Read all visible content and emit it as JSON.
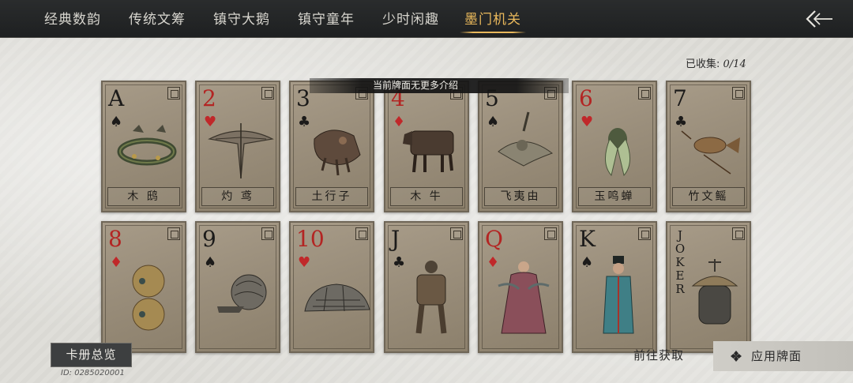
{
  "tabs": [
    {
      "label": "经典数韵",
      "active": false
    },
    {
      "label": "传统文筹",
      "active": false
    },
    {
      "label": "镇守大鹅",
      "active": false
    },
    {
      "label": "镇守童年",
      "active": false
    },
    {
      "label": "少时闲趣",
      "active": false
    },
    {
      "label": "墨门机关",
      "active": true
    }
  ],
  "collected": {
    "label": "已收集: ",
    "count": "0/14"
  },
  "tooltip": "当前牌面无更多介绍",
  "cards_row1": [
    {
      "rank": "A",
      "suit": "♠",
      "suit_color": "black",
      "name": "木 鸱",
      "icon": "wooden-kite-icon"
    },
    {
      "rank": "2",
      "suit": "♥",
      "suit_color": "red",
      "name": "灼 鸢",
      "icon": "glider-icon"
    },
    {
      "rank": "3",
      "suit": "♣",
      "suit_color": "black",
      "name": "土行子",
      "icon": "mole-machine-icon"
    },
    {
      "rank": "4",
      "suit": "♦",
      "suit_color": "red",
      "name": "木 牛",
      "icon": "wooden-ox-icon"
    },
    {
      "rank": "5",
      "suit": "♠",
      "suit_color": "black",
      "name": "飞夷由",
      "icon": "flying-squirrel-icon"
    },
    {
      "rank": "6",
      "suit": "♥",
      "suit_color": "red",
      "name": "玉鸣蝉",
      "icon": "cicada-icon"
    },
    {
      "rank": "7",
      "suit": "♣",
      "suit_color": "black",
      "name": "竹文鳐",
      "icon": "flying-fish-icon"
    }
  ],
  "cards_row2": [
    {
      "rank": "8",
      "suit": "♦",
      "suit_color": "red",
      "icon": "gourd-bot-icon"
    },
    {
      "rank": "9",
      "suit": "♠",
      "suit_color": "black",
      "icon": "snail-machine-icon"
    },
    {
      "rank": "10",
      "suit": "♥",
      "suit_color": "red",
      "icon": "armadillo-machine-icon"
    },
    {
      "rank": "J",
      "suit": "♣",
      "suit_color": "black",
      "icon": "mech-warrior-icon"
    },
    {
      "rank": "Q",
      "suit": "♦",
      "suit_color": "red",
      "icon": "lady-figure-icon"
    },
    {
      "rank": "K",
      "suit": "♠",
      "suit_color": "black",
      "icon": "scholar-figure-icon"
    },
    {
      "rank": "JOKER",
      "suit": "",
      "suit_color": "black",
      "icon": "lantern-bot-icon"
    }
  ],
  "buttons": {
    "album": "卡册总览",
    "player_id": "ID: 0285020001",
    "goto": "前往获取",
    "apply": "应用牌面"
  },
  "colors": {
    "accent": "#e9b85b",
    "card_bg": "#9a8e7b",
    "red_suit": "#b32523",
    "topbar": "#222425"
  }
}
